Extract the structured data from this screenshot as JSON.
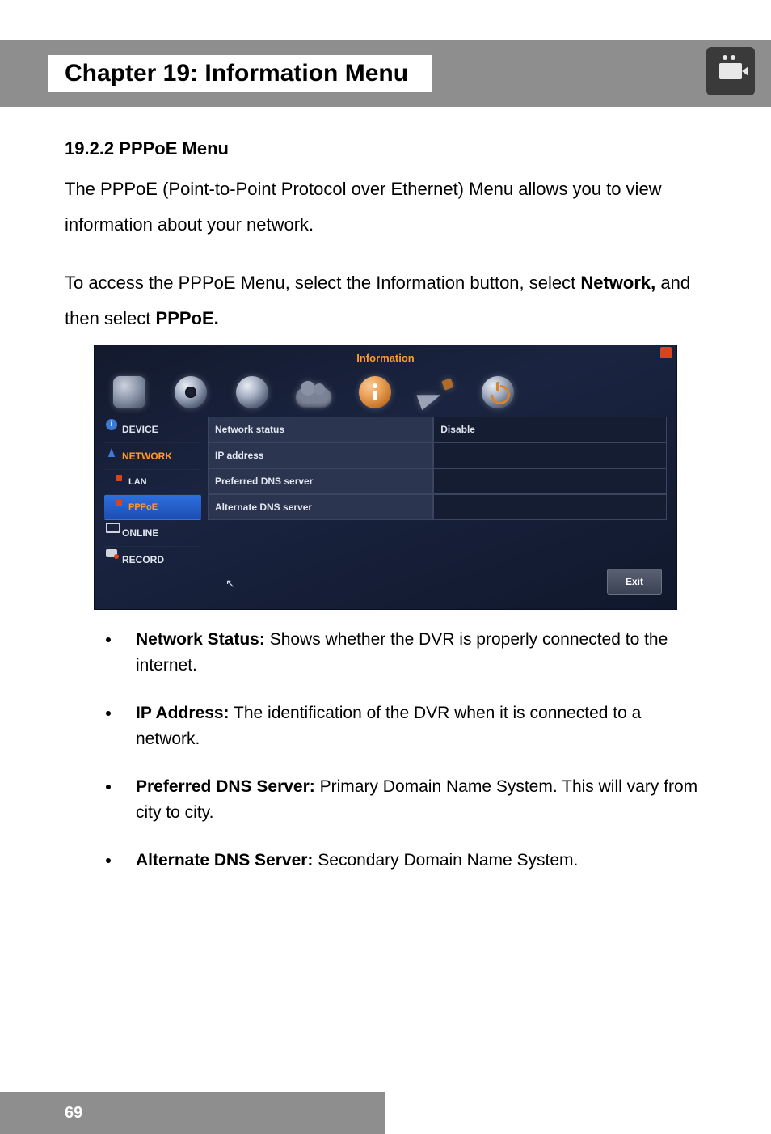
{
  "chapter": {
    "title": "Chapter 19: Information Menu"
  },
  "section": {
    "number_title": "19.2.2 PPPoE Menu"
  },
  "intro": {
    "para1": "The PPPoE (Point-to-Point Protocol over Ethernet) Menu allows you to view information about your network.",
    "para2_pre": "To access the PPPoE Menu, select the Information button, select ",
    "para2_bold1": "Network,",
    "para2_mid": " and then select ",
    "para2_bold2": "PPPoE."
  },
  "screenshot": {
    "window_title": "Information",
    "sidebar": {
      "items": [
        {
          "label": "DEVICE"
        },
        {
          "label": "NETWORK"
        },
        {
          "label": "LAN"
        },
        {
          "label": "PPPoE"
        },
        {
          "label": "ONLINE"
        },
        {
          "label": "RECORD"
        }
      ]
    },
    "table": {
      "rows": [
        {
          "label": "Network status",
          "value": "Disable"
        },
        {
          "label": "IP address",
          "value": ""
        },
        {
          "label": "Preferred DNS server",
          "value": ""
        },
        {
          "label": "Alternate DNS server",
          "value": ""
        }
      ]
    },
    "exit_label": "Exit"
  },
  "bullets": [
    {
      "term": "Network Status:",
      "desc": " Shows whether the DVR is properly connected to the internet."
    },
    {
      "term": "IP Address:",
      "desc": " The identification of the DVR when it is connected to a network."
    },
    {
      "term": "Preferred DNS Server:",
      "desc": " Primary Domain Name System. This will vary from city to city."
    },
    {
      "term": "Alternate DNS Server:",
      "desc": " Secondary Domain Name System."
    }
  ],
  "page_number": "69"
}
